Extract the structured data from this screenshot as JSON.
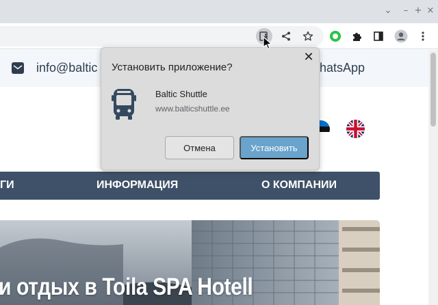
{
  "window": {
    "minimize_glyph": "–",
    "maximize_glyph": "+",
    "close_glyph": "×",
    "chevron_glyph": "⌄"
  },
  "toolbar": {
    "icons": [
      "install-app-icon",
      "share-icon",
      "bookmark-star-icon",
      "extension-green-icon",
      "extensions-puzzle-icon",
      "side-panel-icon",
      "profile-icon",
      "menu-icon"
    ]
  },
  "page": {
    "email": "info@baltic",
    "whatsapp": "WhatsApp",
    "nav": [
      "ГИ",
      "ИНФОРМАЦИЯ",
      "О КОМПАНИИ"
    ],
    "hero_title": "и отдых в Toila SPA Hotell",
    "colors": {
      "nav_bg": "#3e5168",
      "topbar_bg": "#f3f6fa",
      "text_dark": "#2f3e4e"
    }
  },
  "dialog": {
    "title": "Установить приложение?",
    "close": "✕",
    "app_name": "Baltic Shuttle",
    "app_url": "www.balticshuttle.ee",
    "cancel_label": "Отмена",
    "install_label": "Установить",
    "colors": {
      "bg": "#dcdcdc",
      "install_btn": "#6aa3cc"
    }
  }
}
